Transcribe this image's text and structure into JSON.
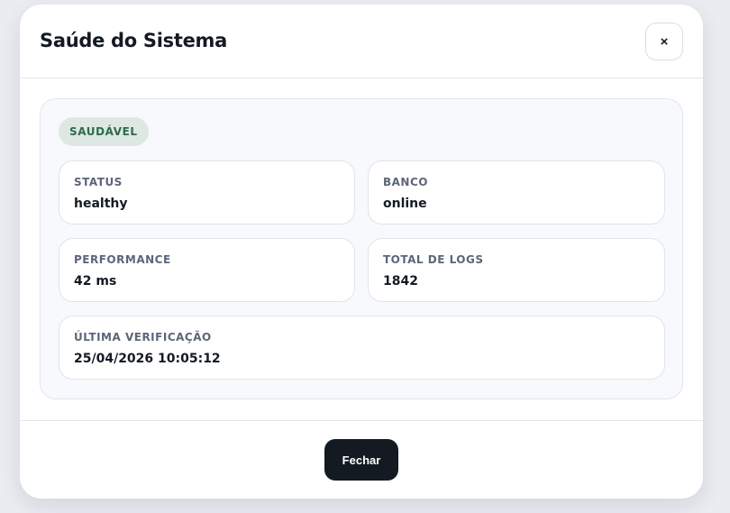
{
  "modal": {
    "title": "Saúde do Sistema",
    "close_label": "×",
    "badge": "SAUDÁVEL",
    "cards": {
      "status": {
        "label": "STATUS",
        "value": "healthy"
      },
      "banco": {
        "label": "BANCO",
        "value": "online"
      },
      "performance": {
        "label": "PERFORMANCE",
        "value": "42 ms"
      },
      "total_logs": {
        "label": "TOTAL DE LOGS",
        "value": "1842"
      },
      "ultima_verificacao": {
        "label": "ÚLTIMA VERIFICAÇÃO",
        "value": "25/04/2026 10:05:12"
      }
    },
    "footer": {
      "close_button": "Fechar"
    }
  },
  "colors": {
    "badge_bg": "#dde8e3",
    "badge_text": "#2f6a4b",
    "primary_button": "#141a22"
  }
}
